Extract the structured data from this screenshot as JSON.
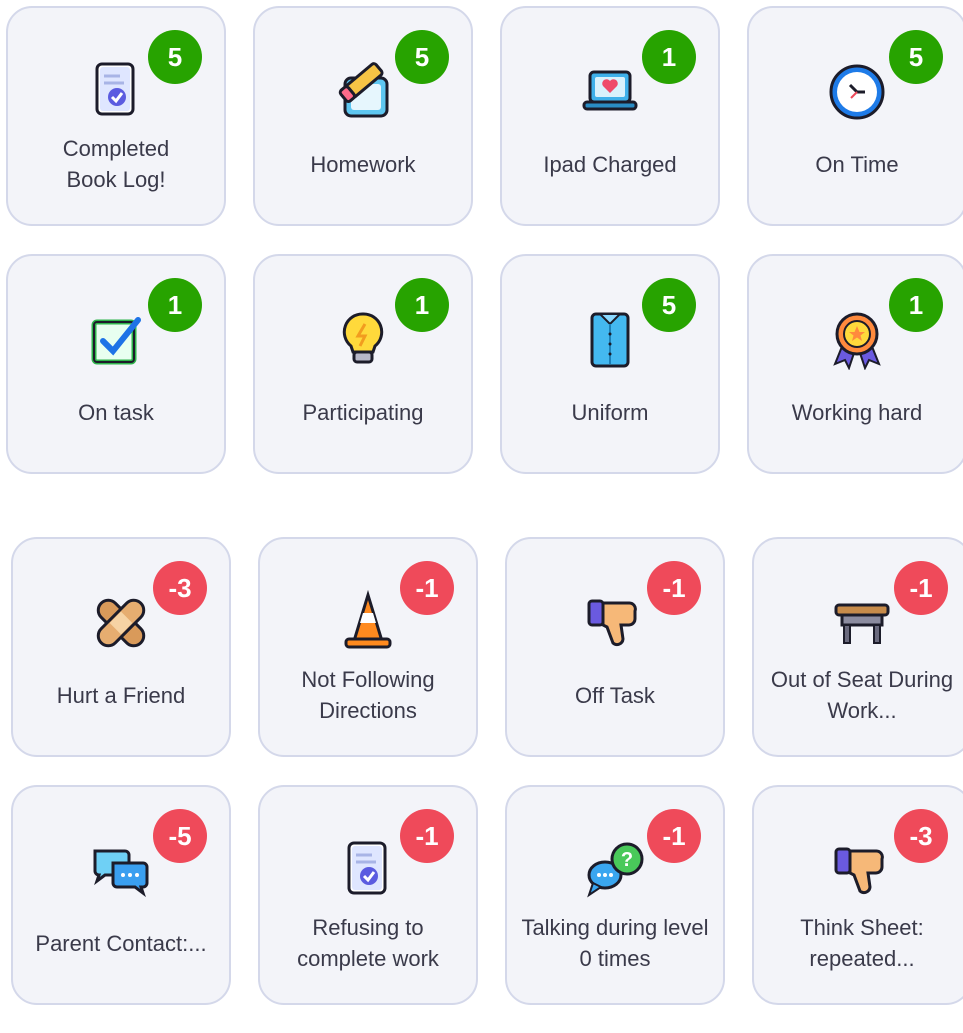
{
  "positive_skills": [
    {
      "label": "Completed\nBook Log!",
      "points": "5",
      "icon": "document-check-icon"
    },
    {
      "label": "Homework",
      "points": "5",
      "icon": "pencil-paper-icon"
    },
    {
      "label": "Ipad Charged",
      "points": "1",
      "icon": "laptop-heart-icon"
    },
    {
      "label": "On Time",
      "points": "5",
      "icon": "clock-icon"
    },
    {
      "label": "On task",
      "points": "1",
      "icon": "checkbox-icon"
    },
    {
      "label": "Participating",
      "points": "1",
      "icon": "lightbulb-icon"
    },
    {
      "label": "Uniform",
      "points": "5",
      "icon": "shirt-icon"
    },
    {
      "label": "Working hard",
      "points": "1",
      "icon": "medal-icon"
    }
  ],
  "negative_skills": [
    {
      "label": "Hurt a Friend",
      "points": "-3",
      "icon": "bandage-icon"
    },
    {
      "label": "Not Following Directions",
      "points": "-1",
      "icon": "traffic-cone-icon"
    },
    {
      "label": "Off Task",
      "points": "-1",
      "icon": "thumbs-down-icon"
    },
    {
      "label": "Out of Seat During Work...",
      "points": "-1",
      "icon": "desk-icon"
    },
    {
      "label": "Parent Contact:...",
      "points": "-5",
      "icon": "chat-bubbles-icon"
    },
    {
      "label": "Refusing to complete work",
      "points": "-1",
      "icon": "document-check-icon"
    },
    {
      "label": "Talking during level 0 times",
      "points": "-1",
      "icon": "speech-question-icon"
    },
    {
      "label": "Think Sheet: repeated...",
      "points": "-3",
      "icon": "thumbs-down-icon"
    }
  ],
  "colors": {
    "positive_badge": "#27a300",
    "negative_badge": "#ef4a5a",
    "card_background": "#f3f4f9",
    "card_border": "#d4d8ea",
    "label_text": "#3a3a4a"
  }
}
